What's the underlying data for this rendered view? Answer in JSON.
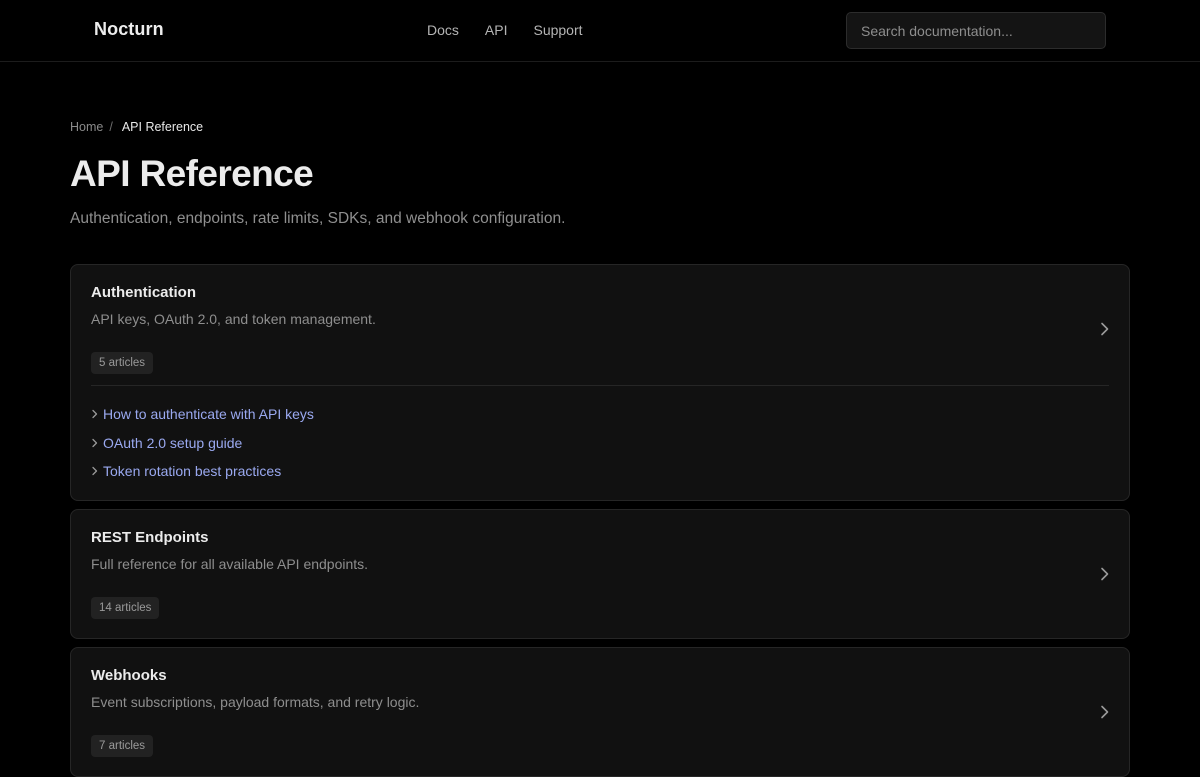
{
  "brand": "Nocturn",
  "nav": [
    {
      "label": "Docs"
    },
    {
      "label": "API"
    },
    {
      "label": "Support"
    }
  ],
  "search": {
    "placeholder": "Search documentation..."
  },
  "breadcrumb": {
    "home": "Home",
    "separator": "/",
    "current": "API Reference"
  },
  "page": {
    "title": "API Reference",
    "description": "Authentication, endpoints, rate limits, SDKs, and webhook configuration."
  },
  "cards": [
    {
      "title": "Authentication",
      "description": "API keys, OAuth 2.0, and token management.",
      "badge": "5 articles",
      "articles": [
        {
          "label": "How to authenticate with API keys"
        },
        {
          "label": "OAuth 2.0 setup guide"
        },
        {
          "label": "Token rotation best practices"
        }
      ]
    },
    {
      "title": "REST Endpoints",
      "description": "Full reference for all available API endpoints.",
      "badge": "14 articles"
    },
    {
      "title": "Webhooks",
      "description": "Event subscriptions, payload formats, and retry logic.",
      "badge": "7 articles"
    }
  ],
  "colors": {
    "background": "#000000",
    "card": "#111111",
    "link": "#9aa9f0",
    "muted_text": "#8e8e8e"
  },
  "icons": {
    "card_chevron": "chevron-right-icon",
    "article_chevron": "chevron-right-small-icon"
  }
}
